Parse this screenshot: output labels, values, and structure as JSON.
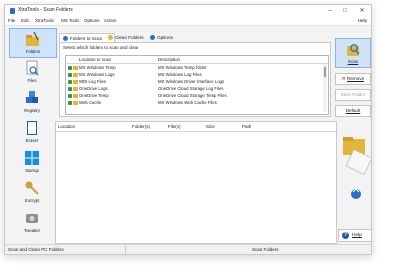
{
  "window": {
    "title": "XtraTools - Scan Folders",
    "controls": {
      "minimize": "–",
      "maximize": "□",
      "close": "✕"
    }
  },
  "menu": {
    "items": [
      "File",
      "Edit",
      "XtraTools",
      "MS Tools",
      "Options",
      "Action"
    ],
    "help": "Help"
  },
  "sidebar": {
    "items": [
      {
        "label": "Folders",
        "icon": "folder-broom-icon",
        "selected": true
      },
      {
        "label": "Files",
        "icon": "file-search-icon",
        "selected": false
      },
      {
        "label": "Registry",
        "icon": "registry-cubes-icon",
        "selected": false
      },
      {
        "label": "Eraser",
        "icon": "eraser-icon",
        "selected": false
      },
      {
        "label": "Startup",
        "icon": "windows-logo-icon",
        "selected": false
      },
      {
        "label": "Encrypt",
        "icon": "key-icon",
        "selected": false
      },
      {
        "label": "Tweaker",
        "icon": "tweaker-icon",
        "selected": false
      }
    ]
  },
  "tabs": [
    {
      "label": "Folders to Scan",
      "active": true
    },
    {
      "label": "Clean Folders",
      "active": false
    },
    {
      "label": "Options",
      "active": false
    }
  ],
  "folders_panel": {
    "instruction": "Select which folders to scan and clear",
    "columns": [
      "Location to scan",
      "Description"
    ],
    "rows": [
      {
        "location": "MS Windows Temp",
        "description": "MS Windows Temp folder",
        "checked": true
      },
      {
        "location": "MS Windows Logs",
        "description": "MS Windows Log Files",
        "checked": true
      },
      {
        "location": "WDI Log Files",
        "description": "MS Windows Driver Interface Logs",
        "checked": true
      },
      {
        "location": "OneDrive Logs",
        "description": "OneDrive Cloud Storage Log Files",
        "checked": true
      },
      {
        "location": "OneDrive Temp",
        "description": "OneDrive Cloud Storage Temp Files",
        "checked": true
      },
      {
        "location": "Web Cache",
        "description": "MS Windows Web Cache Files",
        "checked": true
      }
    ]
  },
  "actions": {
    "scan": "Scan",
    "remove": "Remove",
    "save_folder": "Save Folder",
    "default": "Default"
  },
  "results_table": {
    "columns": [
      "Location",
      "Folder(s)",
      "File(s)",
      "Size",
      "Path"
    ]
  },
  "help": {
    "label": "Help"
  },
  "status": {
    "left": "Scan and Clean PC Folders",
    "middle": "Scan Folders"
  },
  "colors": {
    "accent": "#2a6fc9",
    "selected_bg": "#cfe4f8",
    "checkbox": "#2f9b3c",
    "folder": "#e3b53a",
    "remove_x": "#d12b2b"
  }
}
